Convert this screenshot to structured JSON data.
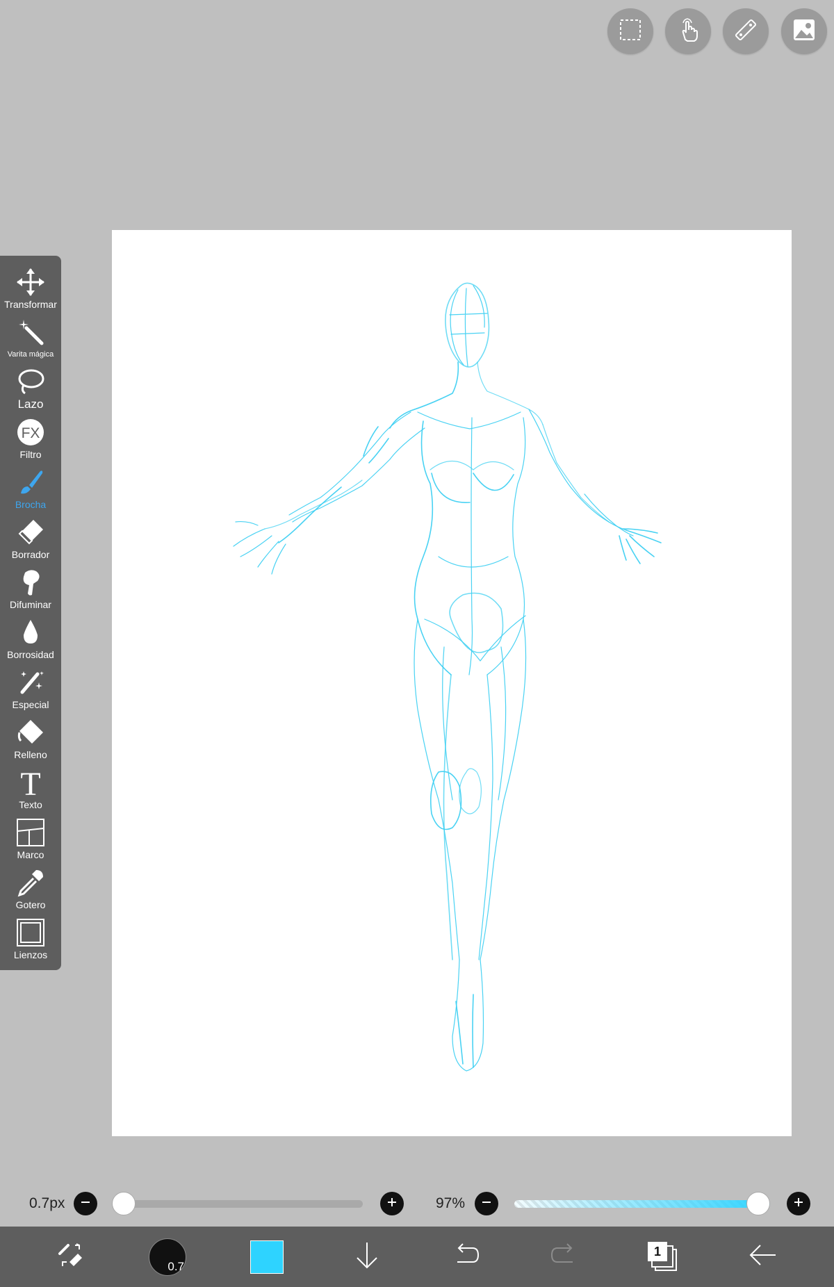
{
  "top_actions": [
    {
      "name": "selection-button",
      "icon": "dashed-rectangle-icon"
    },
    {
      "name": "touch-button",
      "icon": "hand-touch-icon"
    },
    {
      "name": "ruler-button",
      "icon": "ruler-icon"
    },
    {
      "name": "image-button",
      "icon": "image-icon"
    }
  ],
  "toolbox": {
    "active_color": "#3ea6ee",
    "tools": [
      {
        "label": "Transformar",
        "icon": "move-arrows-icon"
      },
      {
        "label": "Varita mágica",
        "icon": "magic-wand-icon"
      },
      {
        "label": "Lazo",
        "icon": "lasso-icon"
      },
      {
        "label": "Filtro",
        "icon": "fx-icon"
      },
      {
        "label": "Brocha",
        "icon": "brush-icon"
      },
      {
        "label": "Borrador",
        "icon": "eraser-icon"
      },
      {
        "label": "Difuminar",
        "icon": "smudge-icon"
      },
      {
        "label": "Borrosidad",
        "icon": "blur-drop-icon"
      },
      {
        "label": "Especial",
        "icon": "special-brush-icon"
      },
      {
        "label": "Relleno",
        "icon": "fill-bucket-icon"
      },
      {
        "label": "Texto",
        "icon": "text-icon"
      },
      {
        "label": "Marco",
        "icon": "frame-icon"
      },
      {
        "label": "Gotero",
        "icon": "eyedropper-icon"
      },
      {
        "label": "Lienzos",
        "icon": "canvas-icon"
      }
    ]
  },
  "sliders": {
    "brush_size": {
      "label": "0.7px",
      "value_fraction": 0.0
    },
    "opacity": {
      "label": "97%",
      "value_fraction": 0.97
    }
  },
  "bottom_bar": {
    "brush_size_display": "0.7",
    "current_color": "#2ed3ff",
    "layer_count": "1"
  },
  "sketch_color": "#3fd0f2"
}
